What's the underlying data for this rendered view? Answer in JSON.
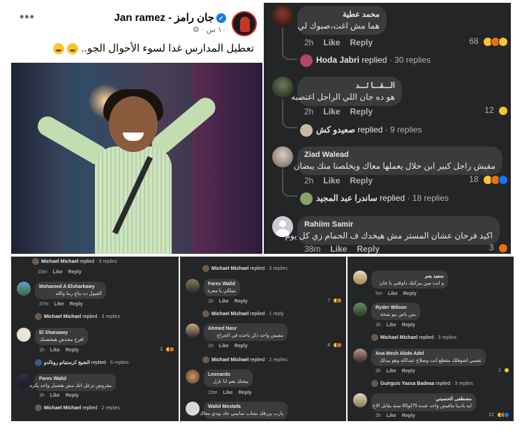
{
  "post": {
    "author": "جان رامز - Jan ramez",
    "meta": "١٠ س · ⚙",
    "more": "•••",
    "text": "تعطيل المدارس غدا لسوء الأحوال الجو..",
    "verified": "✓"
  },
  "panel1": {
    "comments": [
      {
        "name": "محمد عطية",
        "text": "هما مش اغت،صبوك لي",
        "time": "2h",
        "like": "Like",
        "reply": "Reply",
        "count": "68",
        "replied": {
          "who": "Hoda Jabri",
          "verb": "replied",
          "count": "· 30 replies"
        }
      },
      {
        "name": "الـــقـــا ئـــد",
        "text": "هو ده جان اللي الراجل اغتصبه",
        "time": "2h",
        "like": "Like",
        "reply": "Reply",
        "count": "12",
        "replied": {
          "who": "صعيدو كش",
          "verb": "replied",
          "count": "· 9 replies"
        }
      },
      {
        "name": "Ziad Walead",
        "text": "مفيش راجل كبير ابن حلال يعملها معاك ويخلصنا منك يبضان",
        "time": "2h",
        "like": "Like",
        "reply": "Reply",
        "count": "18",
        "replied": {
          "who": "ساندرا عبد المجيد",
          "verb": "replied",
          "count": "· 18 replies"
        }
      },
      {
        "name": "Rahiim Samir",
        "text": "اكيد فرحان عشان المستر مش هيخدك ف الحمام زي كل يوم",
        "time": "38m",
        "like": "Like",
        "reply": "Reply",
        "count": "3"
      }
    ]
  },
  "panel2": {
    "top_replied": {
      "who": "Michael Michael",
      "verb": "replied",
      "count": "· 3 replies"
    },
    "top_actions": {
      "time": "10m",
      "like": "Like",
      "reply": "Reply"
    },
    "comments": [
      {
        "name": "Mohamed A Elsharkawy",
        "text": "القبول ده بتاع ربنا والله",
        "time": "37m",
        "like": "Like",
        "reply": "Reply",
        "replied": {
          "who": "Michael Michael",
          "verb": "replied",
          "count": "· 3 replies"
        }
      },
      {
        "name": "El Sharaawy",
        "text": "افرح محدش هيغتصبك",
        "time": "1h",
        "like": "Like",
        "reply": "Reply",
        "count": "3",
        "replied": {
          "who": "الشيخ كرستيانو رونالدو",
          "verb": "replied",
          "count": "· 6 replies"
        }
      },
      {
        "name": "Fares Walid",
        "text": "مفروض تزعل انك مش هتعمل واحد بكره",
        "time": "1h",
        "like": "Like",
        "reply": "Reply",
        "replied": {
          "who": "Michael Michael",
          "verb": "replied",
          "count": "· 2 replies"
        }
      }
    ]
  },
  "panel3": {
    "top_replied": {
      "who": "Michael Michael",
      "verb": "replied",
      "count": "· 3 replies"
    },
    "comments": [
      {
        "name": "Fares Walid",
        "text": "بتيلكي يا معرة",
        "time": "1h",
        "like": "Like",
        "reply": "Reply",
        "count": "7",
        "replied": {
          "who": "Michael Michael",
          "verb": "replied",
          "count": "· 1 reply"
        }
      },
      {
        "name": "Ahmed Nasr",
        "text": "مفيش واحد ذكر باخده في الجراج",
        "time": "1h",
        "like": "Like",
        "reply": "Reply",
        "count": "4",
        "replied": {
          "who": "Michael Michael",
          "verb": "replied",
          "count": "· 2 replies"
        }
      },
      {
        "name": "Leonardo",
        "text": "بيختك يعم انا نازل",
        "time": "15m",
        "like": "Like",
        "reply": "Reply"
      },
      {
        "name": "Walid Mostafa",
        "text": "يارب يرزقك بشاب تمانيني جاد يودي معاك"
      }
    ]
  },
  "panel4": {
    "comments": [
      {
        "name": "سعيد بعم",
        "text": "و انت مين بيركبك دلوقتي يا جان",
        "time": "5m",
        "like": "Like",
        "reply": "Reply"
      },
      {
        "name": "Ryder Wilson",
        "text": "بس ياض يبو شخة",
        "time": "1h",
        "like": "Like",
        "reply": "Reply",
        "replied": {
          "who": "Michael Michael",
          "verb": "replied",
          "count": "· 3 replies"
        }
      },
      {
        "name": "Ana Mesh Abdo Adel",
        "text": "تفسي اشوفلك مقطع انت وصلاح عبدالله وهو بيدلك",
        "time": "2h",
        "like": "Like",
        "reply": "Reply",
        "count": "1",
        "replied": {
          "who": "Guirguis Yassa Badeaa",
          "verb": "replied",
          "count": "· 3 replies"
        }
      },
      {
        "name": "مصطفى الحسيني",
        "text": "ايه ياديبا مافيش واحد عنده 75لو80 سنه يقابل الاخ",
        "time": "2h",
        "like": "Like",
        "reply": "Reply",
        "count": "22"
      }
    ]
  },
  "colors": {
    "bubble": "#3a3b3c",
    "panel": "#242526",
    "text": "#e4e6eb",
    "muted": "#b0b3b8",
    "like_blue": "#1877f2",
    "haha": "#f7c531",
    "angry": "#e9710f"
  }
}
